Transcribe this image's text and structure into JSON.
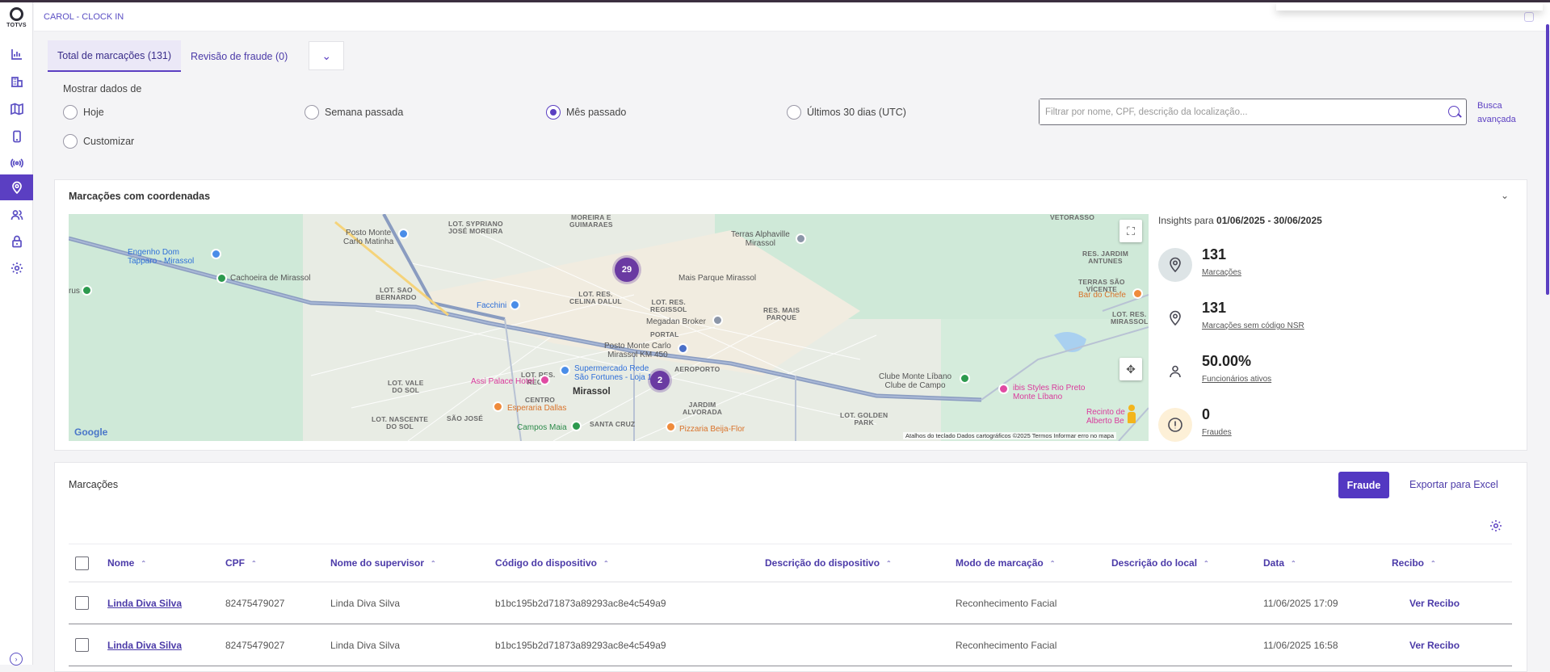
{
  "sidebar": {
    "logo_text": "TOTVS",
    "items": [
      {
        "name": "dashboard",
        "icon": "bar-chart-icon"
      },
      {
        "name": "organization",
        "icon": "building-icon"
      },
      {
        "name": "map",
        "icon": "map-icon"
      },
      {
        "name": "devices",
        "icon": "mobile-icon"
      },
      {
        "name": "wireless",
        "icon": "broadcast-icon"
      },
      {
        "name": "location",
        "icon": "location-pin-icon",
        "active": true
      },
      {
        "name": "users",
        "icon": "users-icon"
      },
      {
        "name": "security",
        "icon": "lock-icon"
      },
      {
        "name": "settings",
        "icon": "gear-icon"
      }
    ],
    "collapse_icon": "chevron-right-icon"
  },
  "header": {
    "title": "CAROL - CLOCK IN"
  },
  "tabs": [
    {
      "label": "Total de marcações (131)",
      "active": true
    },
    {
      "label": "Revisão de fraude (0)",
      "active": false
    }
  ],
  "filters": {
    "label": "Mostrar dados de",
    "options": [
      {
        "label": "Hoje",
        "selected": false
      },
      {
        "label": "Semana passada",
        "selected": false
      },
      {
        "label": "Mês passado",
        "selected": true
      },
      {
        "label": "Últimos 30 dias (UTC)",
        "selected": false
      },
      {
        "label": "Customizar",
        "selected": false
      }
    ],
    "search_placeholder": "Filtrar por nome, CPF, descrição da localização...",
    "advanced_search": "Busca avançada"
  },
  "map_panel": {
    "title": "Marcações com coordenadas",
    "clusters": [
      "29",
      "2"
    ],
    "labels": {
      "l1": "LOT. SYPRIANO\nJOSÉ MOREIRA",
      "l2": "LOT. SAO\nBERNARDO",
      "l3": "LOT. RES.\nCELINA DALUL",
      "l4": "LOT. RES.\nREGISSOL",
      "l5": "RES. MAIS\nPARQUE",
      "l6": "PORTAL",
      "l7": "AEROPORTO",
      "l8": "LOT. VALE\nDO SOL",
      "l9": "LOT. RES.\nREGIS",
      "l10": "CENTRO",
      "l11": "LOT. NASCENTE\nDO SOL",
      "l12": "SÃO JOSÉ",
      "l13": "SANTA CRUZ",
      "l14": "JARDIM\nALVORADA",
      "l15": "LOT. GOLDEN\nPARK",
      "l16": "RES. JARDIM\nANTUNES",
      "l17": "VETORASSO",
      "l18": "TERRAS SÃO\nVÍCENTE",
      "l19": "LOT. RES.\nMIRASSOL",
      "l20": "MOREIRA E\nGUIMARAES"
    },
    "places": {
      "p1": "Posto Monte\nCarlo Matinha",
      "p2": "Engenho Dom\nTapparo - Mirassol",
      "p3": "Cachoeira de Mirassol",
      "p4": "Facchini",
      "p5": "Terras Alphaville\nMirassol",
      "p6": "Mais Parque Mirassol",
      "p7": "Megadan Broker",
      "p8": "Posto Monte Carlo\nMirassol KM 450",
      "p9": "Supermercado Rede\nSão Fortunes - Loja 1",
      "p10": "Assi Palace Hotel",
      "p11": "Esperaria Dallas",
      "p12": "Campos Maia",
      "p13": "Pizzaria Beija-Flor",
      "p14": "Clube Monte Líbano\nClube de Campo",
      "p15": "ibis Styles Rio Preto\nMonte Líbano",
      "p16": "Bar do Chefe",
      "p17": "Recinto de\nAlberto Be",
      "p18": "rus",
      "city": "Mirassol"
    },
    "attribution": "Atalhos do teclado   Dados cartográficos ©2025   Termos   Informar erro no mapa",
    "google": "Google"
  },
  "insights": {
    "prefix": "Insights para ",
    "range": "01/06/2025 - 30/06/2025",
    "items": [
      {
        "value": "131",
        "label": "Marcações",
        "icon": "location-pin-icon",
        "bg": "#dde4e6"
      },
      {
        "value": "131",
        "label": "Marcações sem código NSR",
        "icon": "location-pin-icon",
        "bg": "#ffffff"
      },
      {
        "value": "50.00%",
        "label": "Funcionários ativos",
        "icon": "person-icon",
        "bg": "#ffffff"
      },
      {
        "value": "0",
        "label": "Fraudes",
        "icon": "alert-icon",
        "bg": "#fdf0d7"
      }
    ]
  },
  "marcacoes": {
    "title": "Marcações",
    "fraude_button": "Fraude",
    "export_button": "Exportar para Excel",
    "columns": [
      "Nome",
      "CPF",
      "Nome do supervisor",
      "Código do dispositivo",
      "Descrição do dispositivo",
      "Modo de marcação",
      "Descrição do local",
      "Data",
      "Recibo"
    ],
    "rows": [
      {
        "nome": "Linda Diva Silva",
        "cpf": "82475479027",
        "supervisor": "Linda Diva Silva",
        "codigo": "b1bc195b2d71873a89293ac8e4c549a9",
        "descricao": "",
        "modo": "Reconhecimento Facial",
        "local": "",
        "data": "11/06/2025 17:09",
        "recibo": "Ver Recibo"
      },
      {
        "nome": "Linda Diva Silva",
        "cpf": "82475479027",
        "supervisor": "Linda Diva Silva",
        "codigo": "b1bc195b2d71873a89293ac8e4c549a9",
        "descricao": "",
        "modo": "Reconhecimento Facial",
        "local": "",
        "data": "11/06/2025 16:58",
        "recibo": "Ver Recibo"
      }
    ]
  },
  "colors": {
    "accent": "#5b3fc2",
    "cluster": "#6a3aa2"
  }
}
